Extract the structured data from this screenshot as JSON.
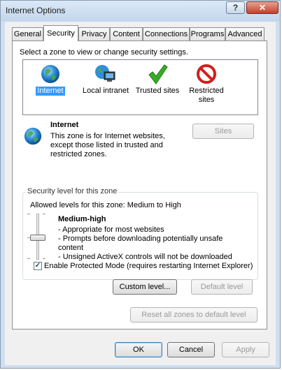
{
  "window": {
    "title": "Internet Options",
    "help_glyph": "?",
    "close_glyph": "✕"
  },
  "tabs": [
    "General",
    "Security",
    "Privacy",
    "Content",
    "Connections",
    "Programs",
    "Advanced"
  ],
  "active_tab": "Security",
  "security": {
    "zone_prompt": "Select a zone to view or change security settings.",
    "zones": {
      "internet": "Internet",
      "local_intranet": "Local intranet",
      "trusted_sites": "Trusted sites",
      "restricted_line1": "Restricted",
      "restricted_line2": "sites"
    },
    "selected_zone": {
      "name": "Internet",
      "desc_line1": "This zone is for Internet websites,",
      "desc_line2": "except those listed in trusted and",
      "desc_line3": "restricted zones."
    },
    "sites_button": "Sites",
    "security_level": {
      "group_title": "Security level for this zone",
      "allowed_levels": "Allowed levels for this zone: Medium to High",
      "level_name": "Medium-high",
      "bullet1": "- Appropriate for most websites",
      "bullet2": "- Prompts before downloading potentially unsafe",
      "bullet2_cont": "content",
      "bullet3": "- Unsigned ActiveX controls will not be downloaded"
    },
    "protected_mode": {
      "checked": true,
      "check_glyph": "✓",
      "label": "Enable Protected Mode (requires restarting Internet Explorer)"
    },
    "custom_level_button": "Custom level...",
    "default_level_button": "Default level",
    "reset_all_button": "Reset all zones to default level"
  },
  "footer": {
    "ok": "OK",
    "cancel": "Cancel",
    "apply": "Apply"
  },
  "colors": {
    "selection": "#3399ff",
    "close_button": "#c2412b",
    "disabled_text": "#9a9a9a"
  }
}
